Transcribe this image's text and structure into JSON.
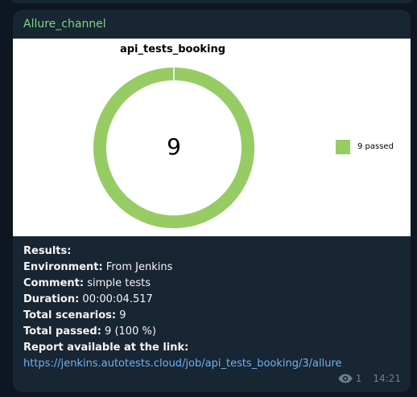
{
  "channel": {
    "name": "Allure_channel"
  },
  "chart_data": {
    "type": "pie",
    "title": "api_tests_booking",
    "center_label": "9",
    "categories": [
      "passed"
    ],
    "values": [
      9
    ],
    "colors": [
      "#97cc64"
    ],
    "legend": [
      "9 passed"
    ],
    "legend_position": "right"
  },
  "results": {
    "heading": "Results:",
    "environment_label": "Environment:",
    "environment_value": " From Jenkins",
    "comment_label": "Comment:",
    "comment_value": " simple tests",
    "duration_label": "Duration:",
    "duration_value": " 00:00:04.517",
    "total_scenarios_label": "Total scenarios:",
    "total_scenarios_value": " 9",
    "total_passed_label": "Total passed:",
    "total_passed_value": " 9 (100 %)",
    "report_label": "Report available at the link:",
    "report_link": "https://jenkins.autotests.cloud/job/api_tests_booking/3/allure"
  },
  "meta": {
    "views": "1",
    "time": "14:21",
    "eye_icon": "eye-icon"
  },
  "colors": {
    "background": "#0e1621",
    "bubble": "#182533",
    "channel_name": "#7fd67f",
    "link": "#6ab3f3",
    "meta": "#6d7f8f",
    "passed": "#97cc64"
  }
}
